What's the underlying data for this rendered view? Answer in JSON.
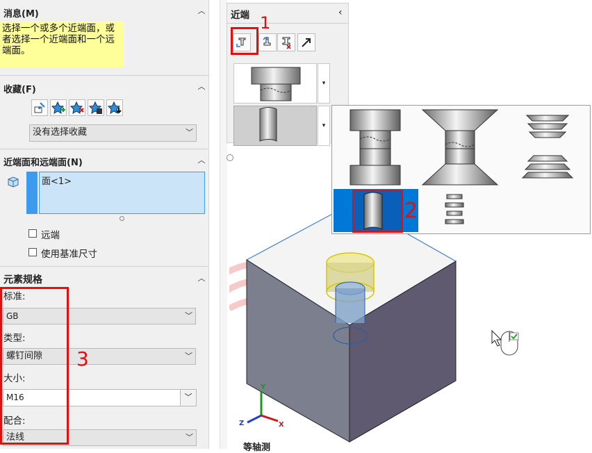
{
  "left_panel": {
    "message": {
      "title": "消息(M)",
      "text": "选择一个或多个近端面，或者选择一个近端面和一个远端面。"
    },
    "favorites": {
      "title": "收藏(F)",
      "selected": "没有选择收藏"
    },
    "faces": {
      "title": "近端面和远端面(N)",
      "items": [
        "面<1>"
      ],
      "far_end_label": "远端",
      "use_base_dim_label": "使用基准尺寸"
    },
    "element_spec": {
      "title": "元素规格",
      "standard_label": "标准:",
      "standard_value": "GB",
      "type_label": "类型:",
      "type_value": "螺钉间隙",
      "size_label": "大小:",
      "size_value": "M16",
      "fit_label": "配合:",
      "fit_value": "法线"
    }
  },
  "mid_panel": {
    "title": "近端"
  },
  "annotations": {
    "num1": "1",
    "num2": "2",
    "num3": "3",
    "color": "#e01010"
  },
  "viewport": {
    "axis_x": "X",
    "axis_y": "Y",
    "axis_z": "Z",
    "bottom_text": "等轴测"
  },
  "colors": {
    "highlight_yellow": "#ffff99",
    "select_blue": "#0078d7",
    "face_list_bg": "#cce4f7"
  }
}
